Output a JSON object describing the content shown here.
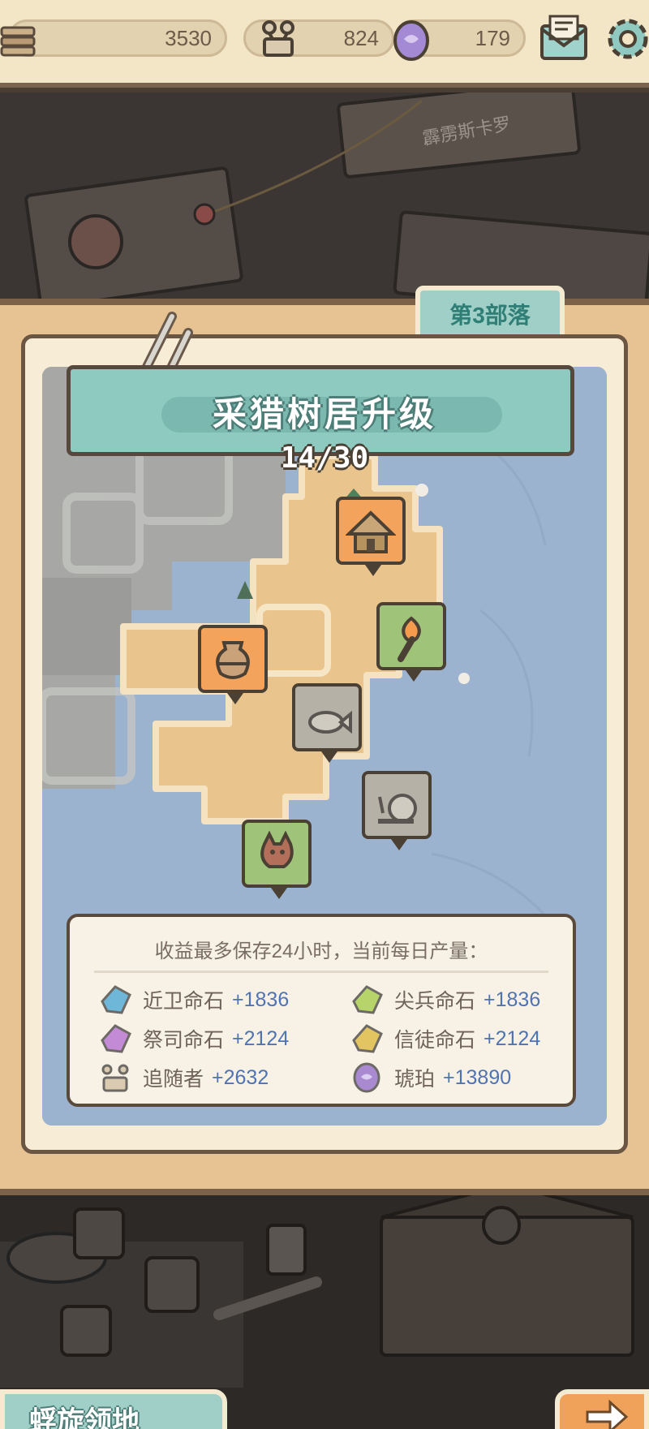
{
  "resources": {
    "resource1_value": "3530",
    "followers_value": "824",
    "amber_value": "179"
  },
  "board": {
    "note_label": "霹雳斯卡罗"
  },
  "tribe_tab": "第3部落",
  "panel": {
    "title": "采猎树居升级",
    "progress": "14/30"
  },
  "map_markers": [
    {
      "name": "hut-marker",
      "icon": "wooden-hut-icon",
      "state": "orange"
    },
    {
      "name": "torch-marker",
      "icon": "torch-icon",
      "state": "green"
    },
    {
      "name": "pot-marker",
      "icon": "clay-pot-icon",
      "state": "orange"
    },
    {
      "name": "fish-marker",
      "icon": "fish-icon",
      "state": "locked"
    },
    {
      "name": "snail-marker",
      "icon": "snail-icon",
      "state": "locked"
    },
    {
      "name": "wolf-marker",
      "icon": "wolf-icon",
      "state": "green"
    }
  ],
  "info": {
    "title": "收益最多保存24小时，当前每日产量：",
    "items": [
      {
        "name": "近卫命石",
        "value": "+1836",
        "icon": "blue-gem-icon",
        "color": "#6fb7d8"
      },
      {
        "name": "尖兵命石",
        "value": "+1836",
        "icon": "green-gem-icon",
        "color": "#b7d46a"
      },
      {
        "name": "祭司命石",
        "value": "+2124",
        "icon": "purple-gem-icon",
        "color": "#c38ad6"
      },
      {
        "name": "信徒命石",
        "value": "+2124",
        "icon": "gold-gem-icon",
        "color": "#e2c460"
      },
      {
        "name": "追随者",
        "value": "+2632",
        "icon": "follower-icon",
        "color": "#b79a86"
      },
      {
        "name": "琥珀",
        "value": "+13890",
        "icon": "amber-icon",
        "color": "#a98ad0"
      }
    ]
  },
  "bottom": {
    "territory_label": "蜉旋领地"
  }
}
